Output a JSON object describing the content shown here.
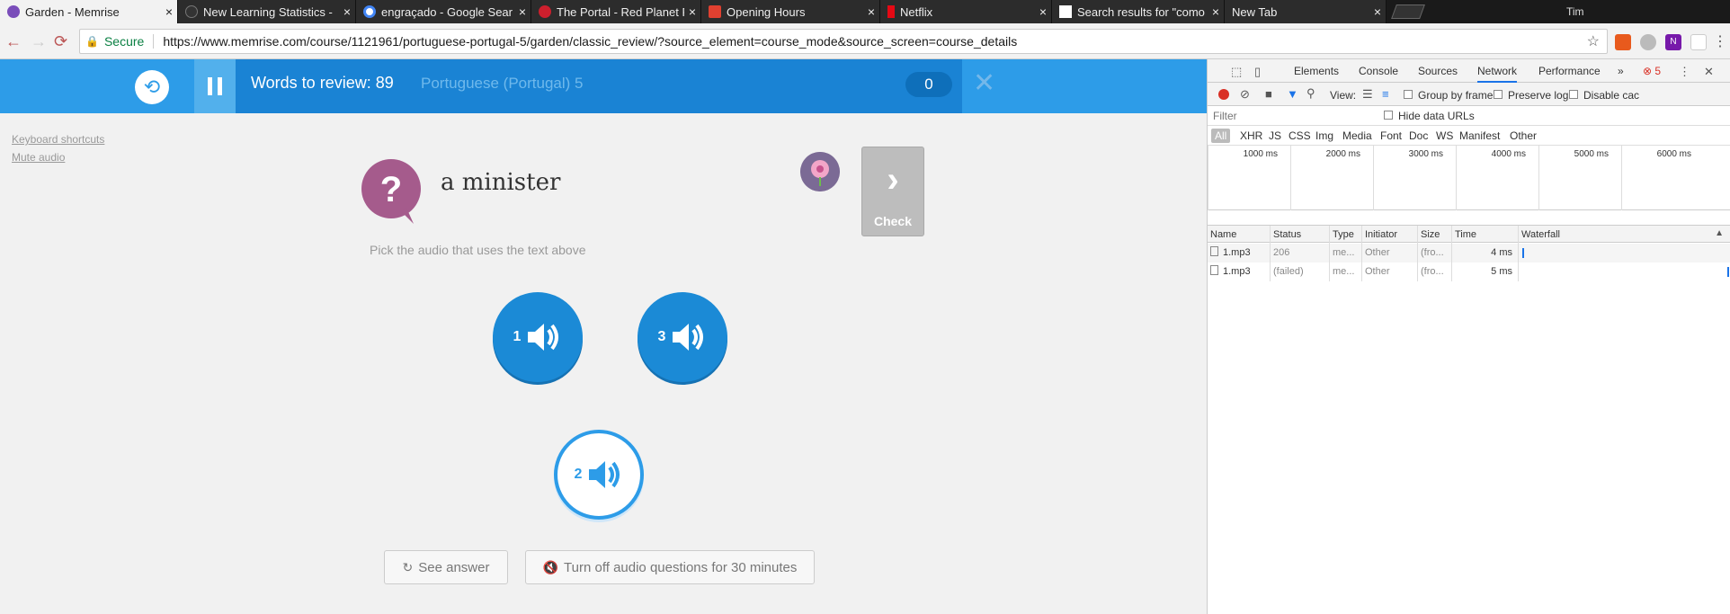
{
  "browser": {
    "tabs": [
      {
        "label": "Garden - Memrise",
        "fav_color": "#7a4dba",
        "active": true
      },
      {
        "label": "New Learning Statistics -",
        "fav_color": "#333333",
        "active": false
      },
      {
        "label": "engraçado - Google Sear",
        "fav_color": "#4285f4",
        "active": false
      },
      {
        "label": "The Portal - Red Planet R",
        "fav_color": "#cc1f2d",
        "active": false
      },
      {
        "label": "Opening Hours",
        "fav_color": "#e04030",
        "active": false
      },
      {
        "label": "Netflix",
        "fav_color": "#e50914",
        "active": false
      },
      {
        "label": "Search results for \"como",
        "fav_color": "#ffffff",
        "active": false
      },
      {
        "label": "New Tab",
        "fav_color": "",
        "active": false
      }
    ],
    "tab_close_glyph": "×",
    "profile_name": "Tim",
    "secure_label": "Secure",
    "url": "https://www.memrise.com/course/1121961/portuguese-portugal-5/garden/classic_review/?source_element=course_mode&source_screen=course_details"
  },
  "memrise": {
    "words_to_review": "Words to review: 89",
    "course_name": "Portuguese (Portugal) 5",
    "score": "0",
    "progress_fraction": 0.0,
    "keyboard_shortcuts": "Keyboard shortcuts",
    "mute_audio": "Mute audio",
    "prompt_word": "a minister",
    "check_label": "Check",
    "instructions": "Pick the audio that uses the text above",
    "audio_options": [
      {
        "number": "1",
        "selected": false
      },
      {
        "number": "3",
        "selected": false
      },
      {
        "number": "2",
        "selected": true
      }
    ],
    "see_answer": "See answer",
    "turn_off_audio": "Turn off audio questions for 30 minutes",
    "colors": {
      "accent": "#2d9ce8",
      "audio_button": "#1b8ad6",
      "prompt_icon": "#a55b8c"
    }
  },
  "devtools": {
    "tabs": [
      "Elements",
      "Console",
      "Sources",
      "Network",
      "Performance"
    ],
    "active_tab": "Network",
    "more_tabs": "»",
    "error_count": "5",
    "toolbar": {
      "view_label": "View:",
      "group_by_frame": "Group by frame",
      "preserve_log": "Preserve log",
      "disable_cache": "Disable cac"
    },
    "filter_placeholder": "Filter",
    "hide_data_urls": "Hide data URLs",
    "type_filters": [
      "All",
      "XHR",
      "JS",
      "CSS",
      "Img",
      "Media",
      "Font",
      "Doc",
      "WS",
      "Manifest",
      "Other"
    ],
    "timeline_labels": [
      "1000 ms",
      "2000 ms",
      "3000 ms",
      "4000 ms",
      "5000 ms",
      "6000 ms"
    ],
    "columns": [
      "Name",
      "Status",
      "Type",
      "Initiator",
      "Size",
      "Time",
      "Waterfall"
    ],
    "rows": [
      {
        "name": "1.mp3",
        "status": "206",
        "type": "me...",
        "initiator": "Other",
        "size": "(fro...",
        "time": "4 ms"
      },
      {
        "name": "1.mp3",
        "status": "(failed)",
        "type": "me...",
        "initiator": "Other",
        "size": "(fro...",
        "time": "5 ms"
      }
    ]
  }
}
